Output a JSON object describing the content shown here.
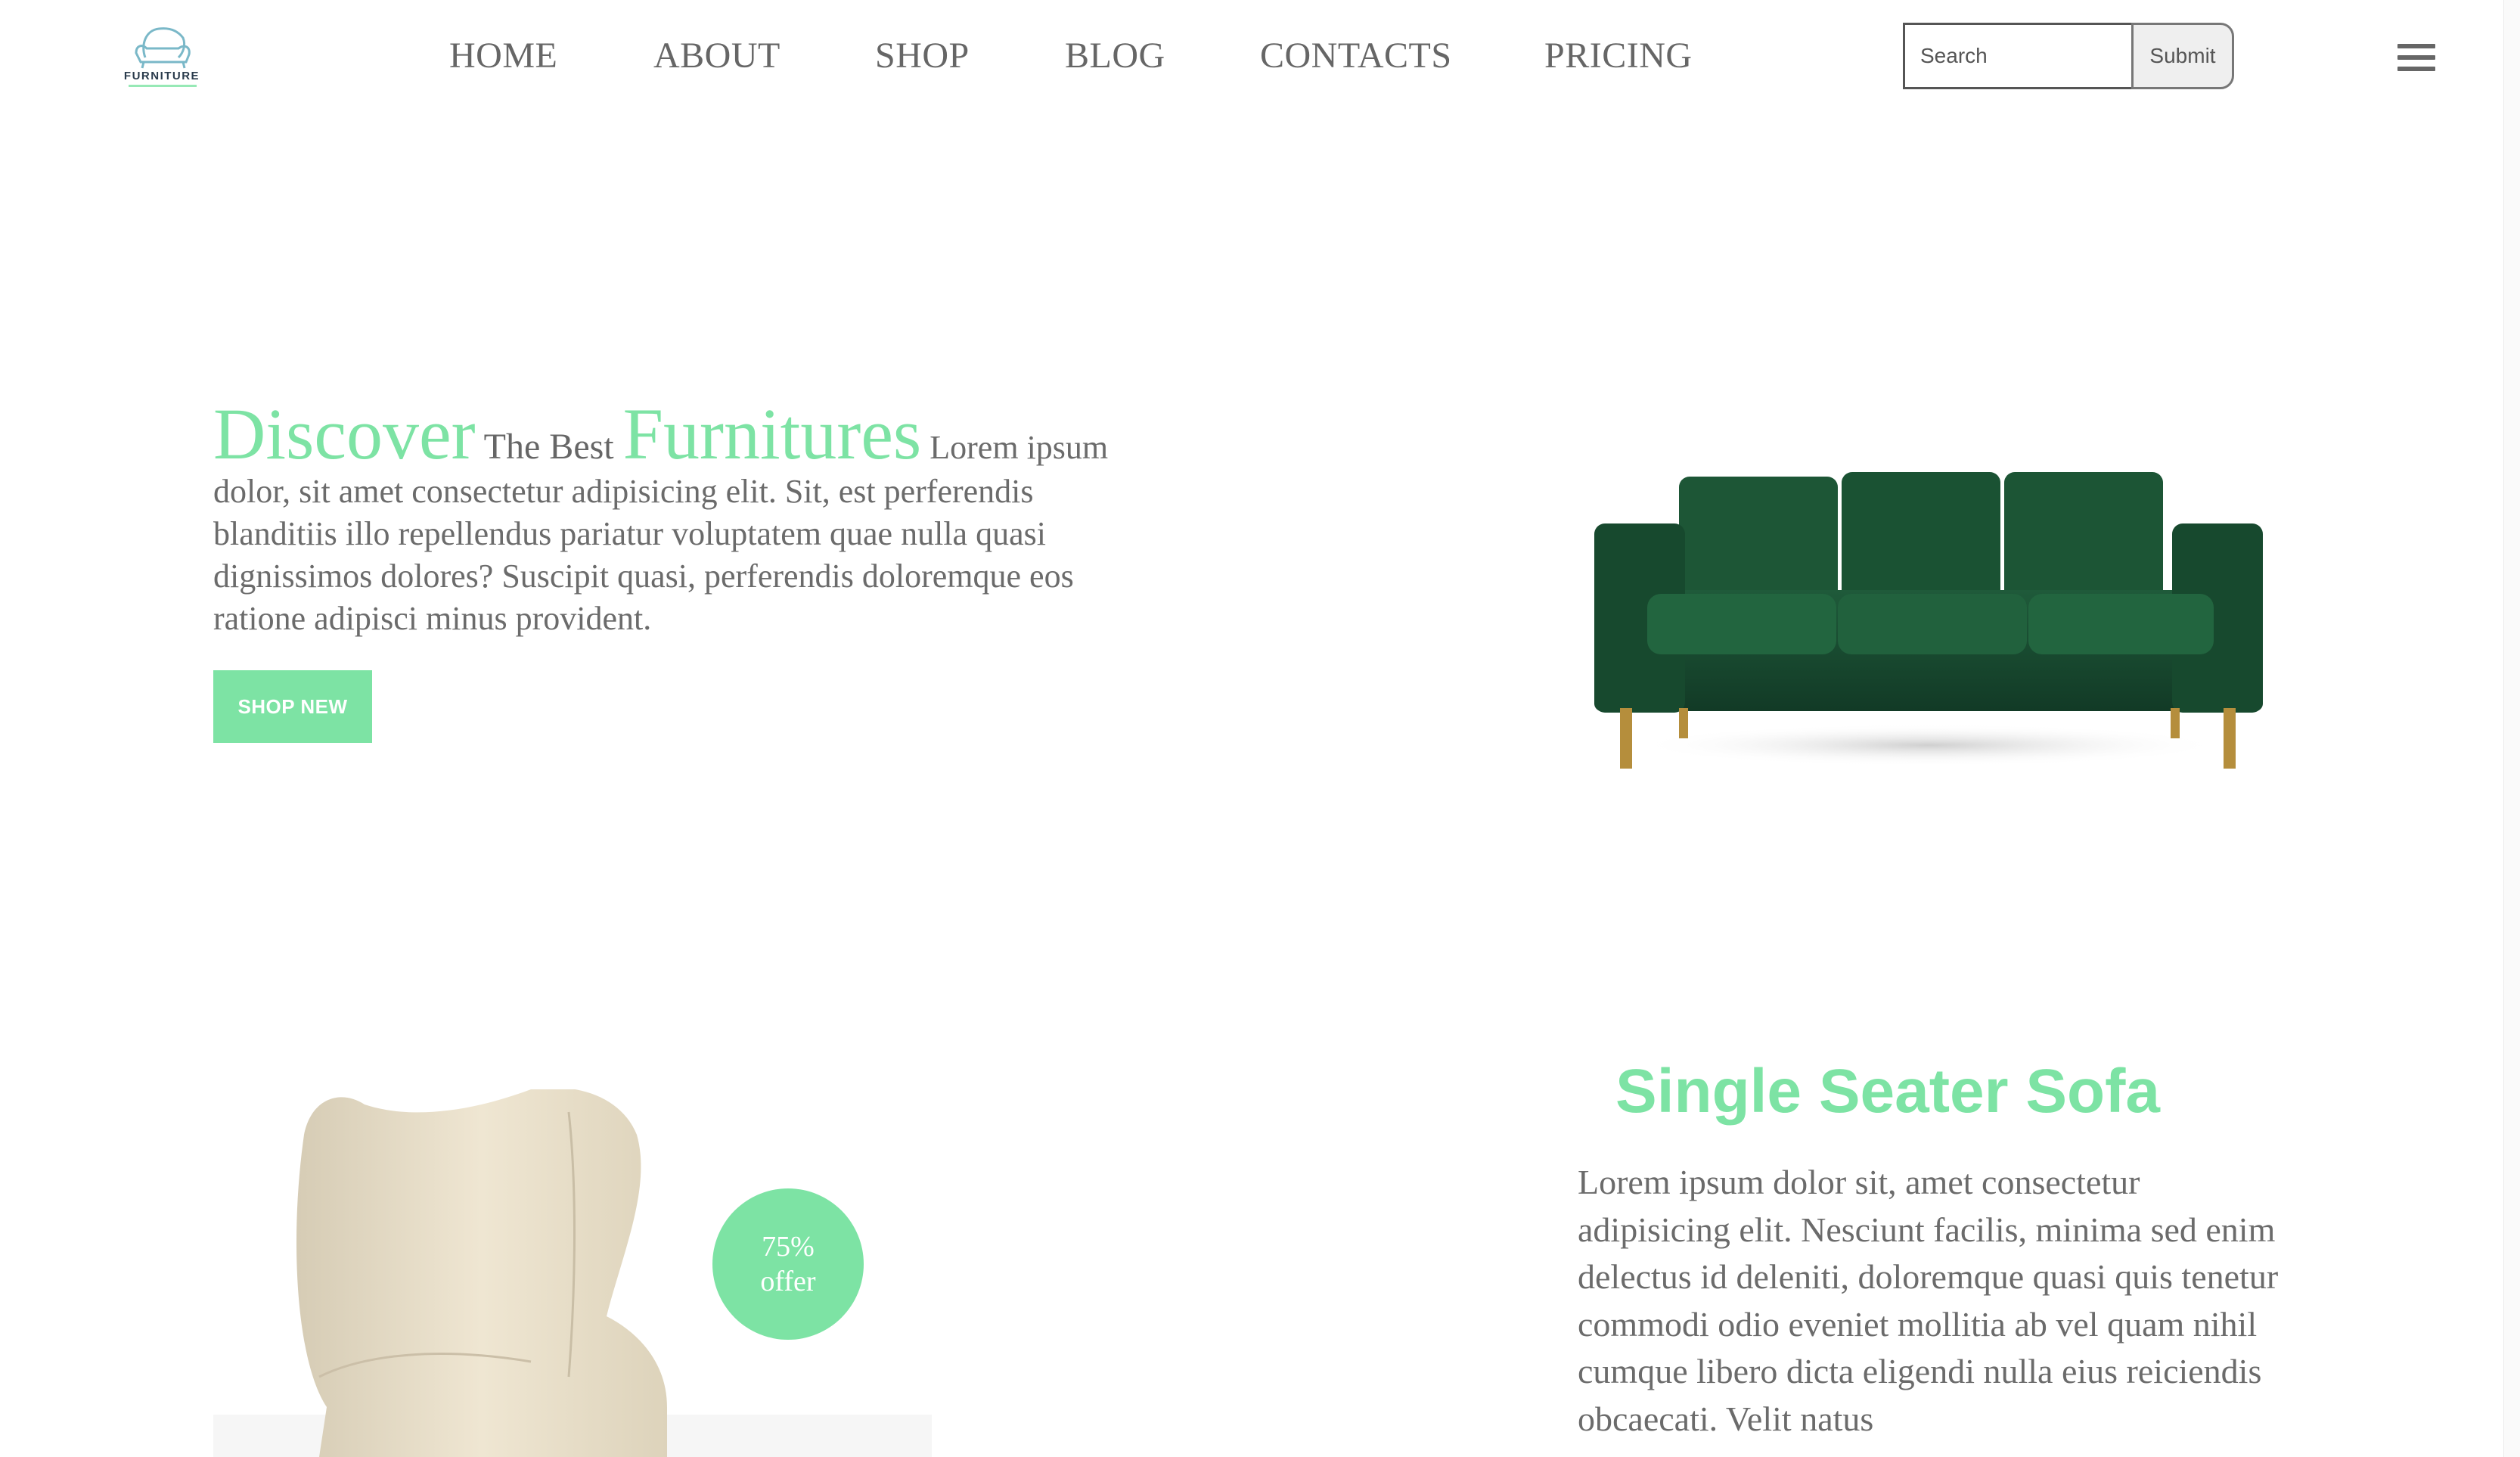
{
  "brand": {
    "logo_text": "FURNITURE",
    "accent_color": "#7de3a4",
    "text_color": "#6b6b6b"
  },
  "nav": {
    "items": [
      "HOME",
      "ABOUT",
      "SHOP",
      "BLOG",
      "CONTACTS",
      "PRICING"
    ]
  },
  "search": {
    "placeholder": "Search",
    "value": "",
    "submit_label": "Submit"
  },
  "menu": {
    "icon": "hamburger-menu-icon"
  },
  "hero": {
    "word1": "Discover",
    "word2": " The Best ",
    "word3": "Furnitures",
    "body": " Lorem ipsum dolor, sit amet consectetur adipisicing elit. Sit, est perferendis blanditiis illo repellendus pariatur voluptatem quae nulla quasi dignissimos dolores? Suscipit quasi, perferendis doloremque eos ratione adipisci minus provident.",
    "cta_label": "SHOP NEW",
    "image": "green-velvet-sofa"
  },
  "product": {
    "title": "Single Seater Sofa",
    "description": "Lorem ipsum dolor sit, amet consectetur adipisicing elit. Nesciunt facilis, minima sed enim delectus id deleniti, doloremque quasi quis tenetur commodi odio eveniet mollitia ab vel quam nihil cumque libero dicta eligendi nulla eius reiciendis obcaecati. Velit natus",
    "badge_line1": "75%",
    "badge_line2": "offer",
    "image": "beige-wingback-armchair"
  }
}
